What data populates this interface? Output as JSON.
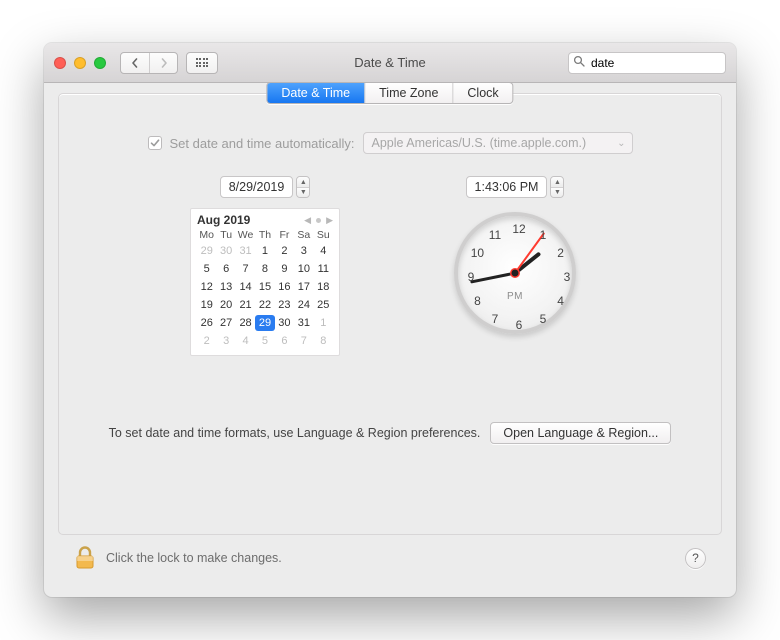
{
  "window": {
    "title": "Date & Time"
  },
  "search": {
    "value": "date"
  },
  "tabs": [
    {
      "label": "Date & Time",
      "active": true
    },
    {
      "label": "Time Zone",
      "active": false
    },
    {
      "label": "Clock",
      "active": false
    }
  ],
  "auto": {
    "checked": true,
    "label": "Set date and time automatically:",
    "server": "Apple Americas/U.S. (time.apple.com.)"
  },
  "date_field": "8/29/2019",
  "time_field": "1:43:06 PM",
  "calendar": {
    "month_label": "Aug 2019",
    "weekdays": [
      "Mo",
      "Tu",
      "We",
      "Th",
      "Fr",
      "Sa",
      "Su"
    ],
    "leading_prev": [
      29,
      30,
      31
    ],
    "days": [
      1,
      2,
      3,
      4,
      5,
      6,
      7,
      8,
      9,
      10,
      11,
      12,
      13,
      14,
      15,
      16,
      17,
      18,
      19,
      20,
      21,
      22,
      23,
      24,
      25,
      26,
      27,
      28,
      29,
      30,
      31
    ],
    "trailing_next": [
      1,
      2,
      3,
      4,
      5,
      6,
      7,
      8
    ],
    "selected_day": 29
  },
  "clock": {
    "ampm": "PM",
    "hour_angle": 51.5,
    "minute_angle": 258.6,
    "second_angle": 36,
    "numerals": [
      "12",
      "1",
      "2",
      "3",
      "4",
      "5",
      "6",
      "7",
      "8",
      "9",
      "10",
      "11"
    ]
  },
  "hint": "To set date and time formats, use Language & Region preferences.",
  "open_lang_region": "Open Language & Region...",
  "lock_msg": "Click the lock to make changes.",
  "help_label": "?"
}
